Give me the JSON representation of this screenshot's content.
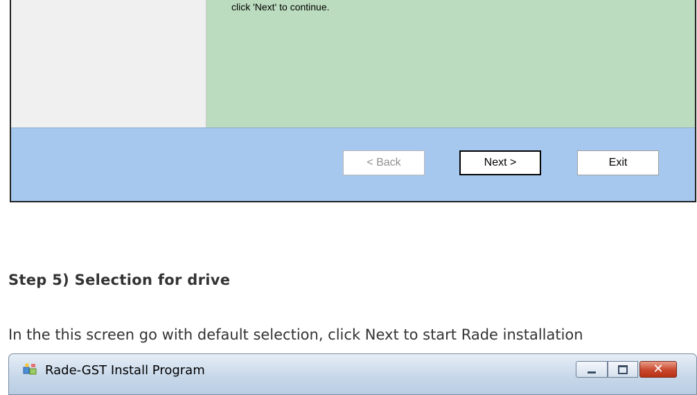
{
  "dialog": {
    "info_text": "click 'Next' to continue.",
    "buttons": {
      "back": "< Back",
      "next": "Next >",
      "exit": "Exit"
    }
  },
  "article": {
    "step_heading": "Step 5) Selection for drive",
    "step_description": "In the this screen go with default selection, click Next to start Rade installation"
  },
  "window2": {
    "title": "Rade-GST Install Program",
    "icon": "installer-icon",
    "close_glyph": "✕"
  },
  "colors": {
    "info_panel": "#bcdcbf",
    "button_bar": "#a6c8ef",
    "close_button": "#c9472c"
  }
}
